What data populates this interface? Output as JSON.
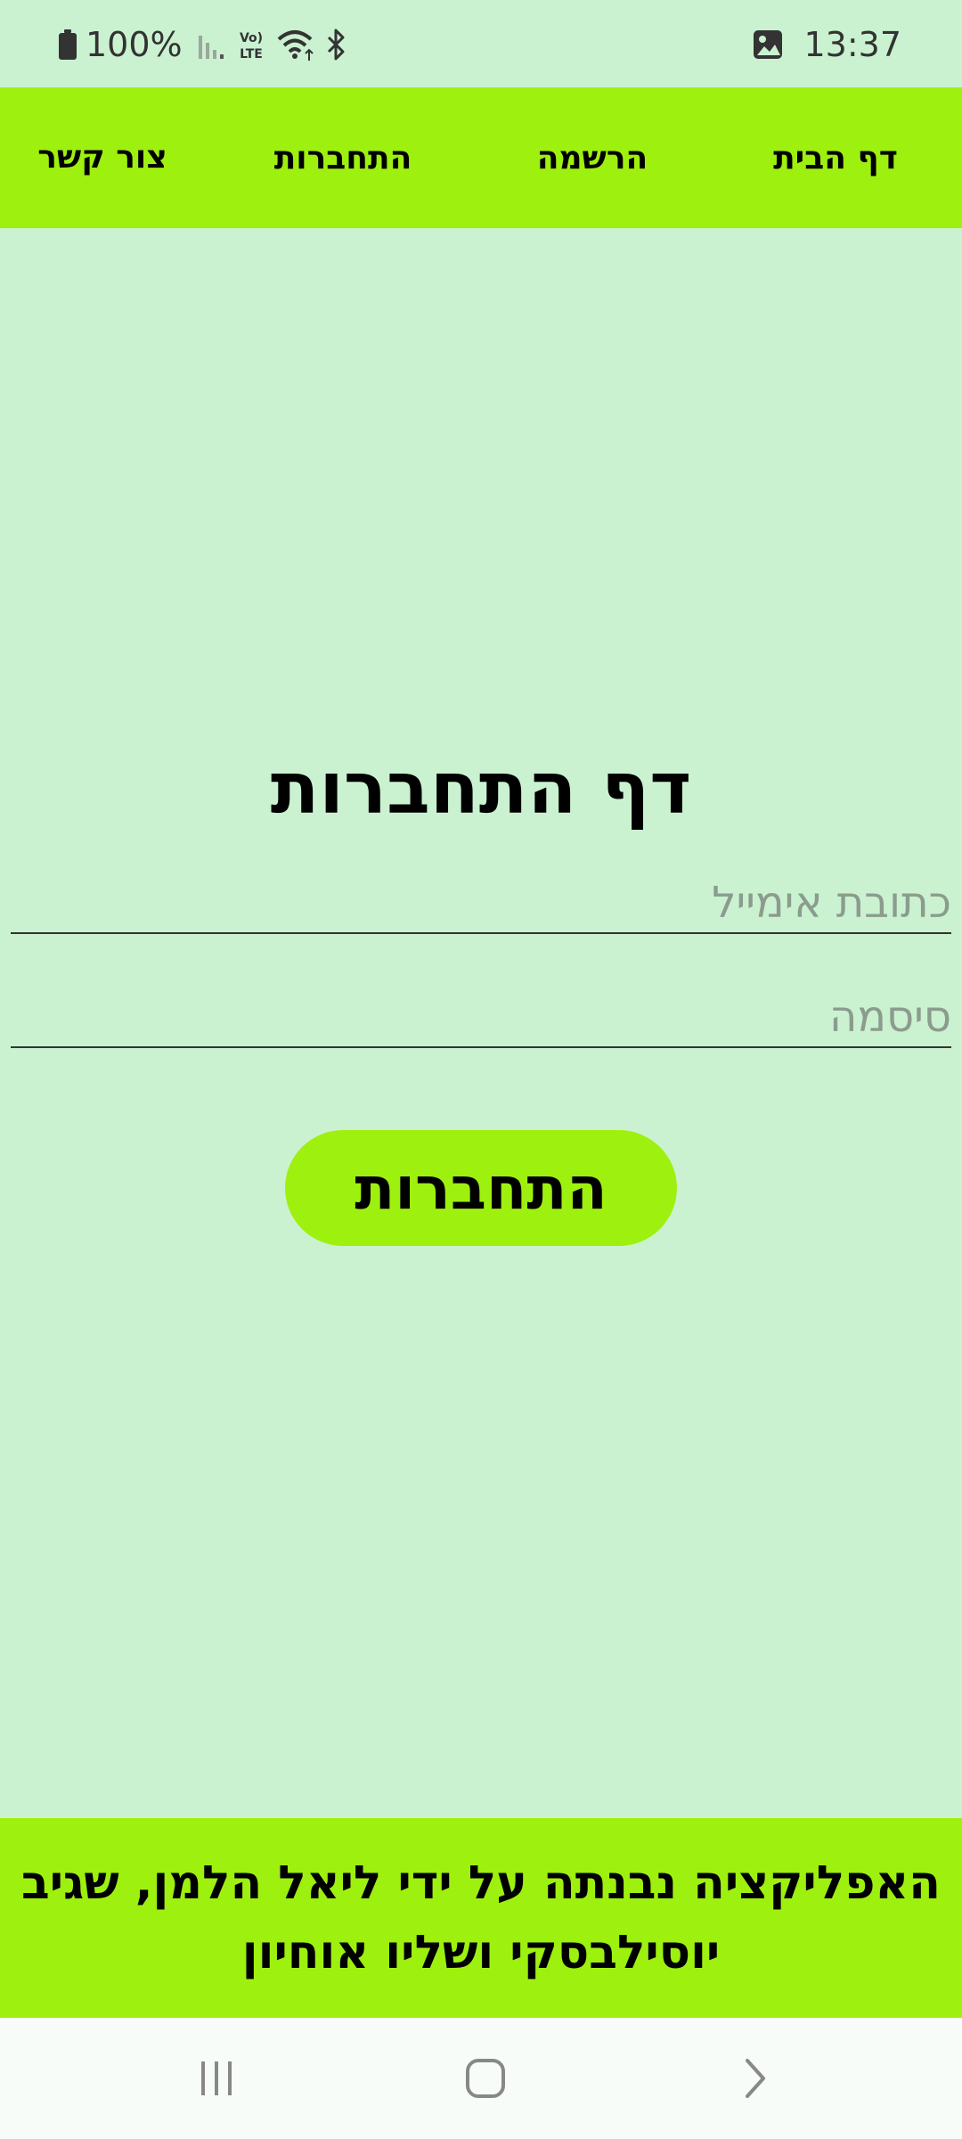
{
  "status_bar": {
    "battery": "100%",
    "time": "13:37",
    "icons": [
      "battery-icon",
      "signal-icon",
      "volte-icon",
      "wifi-icon",
      "bluetooth-icon",
      "gallery-notification-icon"
    ]
  },
  "navbar": {
    "items": [
      {
        "label": "דף הבית"
      },
      {
        "label": "הרשמה"
      },
      {
        "label": "התחברות"
      },
      {
        "label": "צור קשר"
      }
    ]
  },
  "main": {
    "title": "דף התחברות",
    "email_placeholder": "כתובת אימייל",
    "email_value": "",
    "password_placeholder": "סיסמה",
    "password_value": "",
    "login_button": "התחברות"
  },
  "footer": {
    "text": "האפליקציה נבנתה על ידי ליאל הלמן, שגיב יוסילבסקי ושליו אוחיון"
  },
  "system_nav": {
    "icons": [
      "recents-icon",
      "home-icon",
      "back-icon"
    ]
  },
  "colors": {
    "background": "#caf2d0",
    "accent": "#9ef00f",
    "system_nav_background": "#f7fcf8"
  }
}
